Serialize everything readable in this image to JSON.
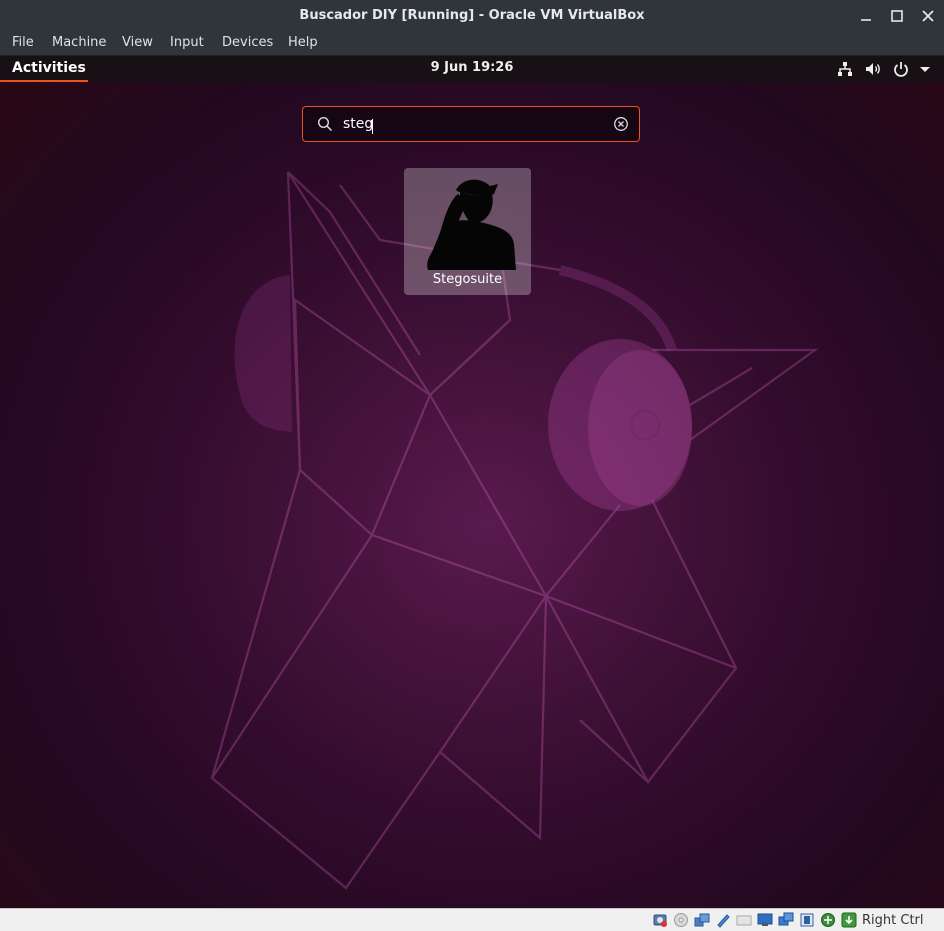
{
  "window": {
    "title": "Buscador DIY [Running] - Oracle VM VirtualBox",
    "minimize_icon": "minimize-icon",
    "maximize_icon": "maximize-icon",
    "close_icon": "close-icon"
  },
  "menubar": {
    "items": [
      "File",
      "Machine",
      "View",
      "Input",
      "Devices",
      "Help"
    ]
  },
  "topbar": {
    "activities": "Activities",
    "clock": "9 Jun  19:26",
    "accent_color": "#e95420",
    "tray_icons": [
      "network-icon",
      "volume-icon",
      "power-icon",
      "chevron-down-icon"
    ]
  },
  "search": {
    "value": "steg",
    "icon": "search-icon",
    "clear_icon": "clear-icon"
  },
  "results": [
    {
      "label": "Stegosuite",
      "icon": "stegosuite-app-icon"
    }
  ],
  "statusbar": {
    "icons": [
      "hard-disk-icon",
      "optical-drive-icon",
      "audio-icon",
      "network-adapter-icon",
      "usb-icon",
      "shared-folders-icon",
      "display-icon",
      "video-capture-icon",
      "cpu-icon",
      "mouse-integration-icon",
      "host-key-icon"
    ],
    "host_key": "Right Ctrl"
  }
}
